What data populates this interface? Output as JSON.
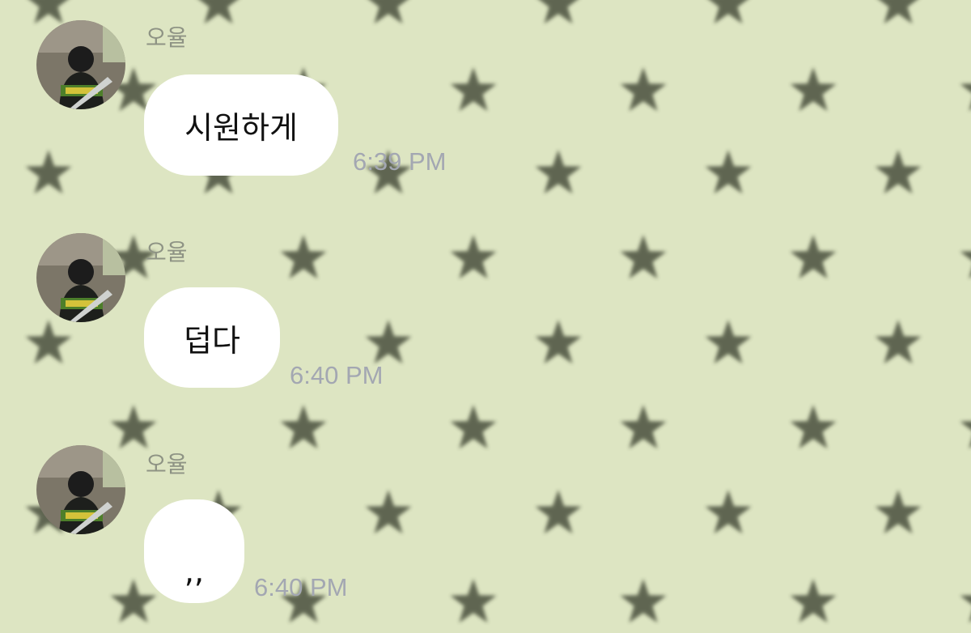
{
  "chat": {
    "messages": [
      {
        "sender": "오율",
        "text": "시원하게",
        "time": "6:39 PM"
      },
      {
        "sender": "오율",
        "text": "덥다",
        "time": "6:40 PM"
      },
      {
        "sender": "오율",
        "text": ",,",
        "time": "6:40 PM"
      }
    ]
  },
  "colors": {
    "background": "#dde5c2",
    "star": "#4a503e",
    "bubble": "#ffffff",
    "timestamp": "#a3a7b2",
    "sender_name": "#8e9384"
  },
  "icons": {
    "wallpaper_pattern": "star-icon"
  }
}
